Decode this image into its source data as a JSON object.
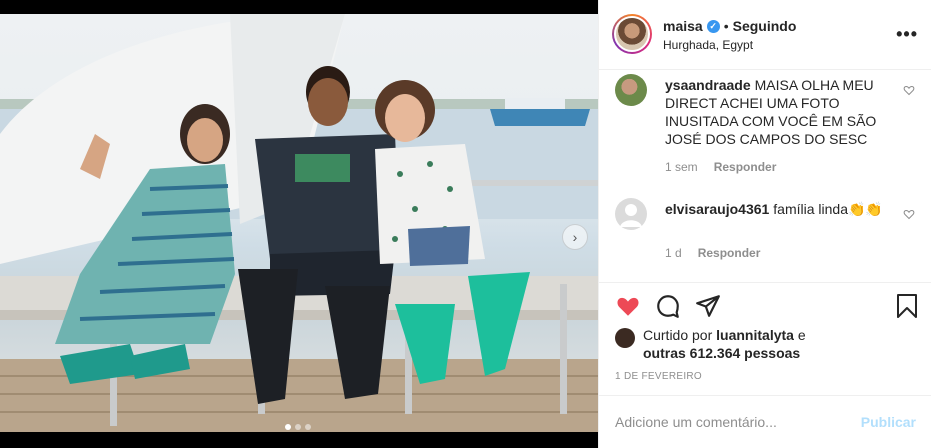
{
  "post": {
    "username": "maisa",
    "separator": "•",
    "follow_label": "Seguindo",
    "location": "Hurghada, Egypt",
    "more_label": "•••"
  },
  "comments": [
    {
      "username": "ysaandraade",
      "text": "MAISA OLHA MEU DIRECT ACHEI UMA FOTO INUSITADA COM VOCÊ EM SÃO JOSÉ DOS CAMPOS DO SESC",
      "time": "1 sem",
      "reply_label": "Responder"
    },
    {
      "username": "elvisaraujo4361",
      "text": "família linda👏👏",
      "time": "1 d",
      "reply_label": "Responder"
    }
  ],
  "likes": {
    "prefix": "Curtido por",
    "user": "luannitalyta",
    "conj": "e",
    "others": "outras 612.364 pessoas"
  },
  "date": "1 DE FEVEREIRO",
  "add_comment": {
    "placeholder": "Adicione um comentário...",
    "post_label": "Publicar"
  },
  "carousel": {
    "next_label": "›",
    "current_slide": 1,
    "total_slides": 3
  },
  "colors": {
    "like_red": "#ed4956",
    "verified_blue": "#3897f0",
    "post_disabled": "#b2dffc"
  },
  "icons": {
    "like": "heart-icon",
    "comment": "comment-icon",
    "share": "share-icon",
    "save": "bookmark-icon"
  }
}
